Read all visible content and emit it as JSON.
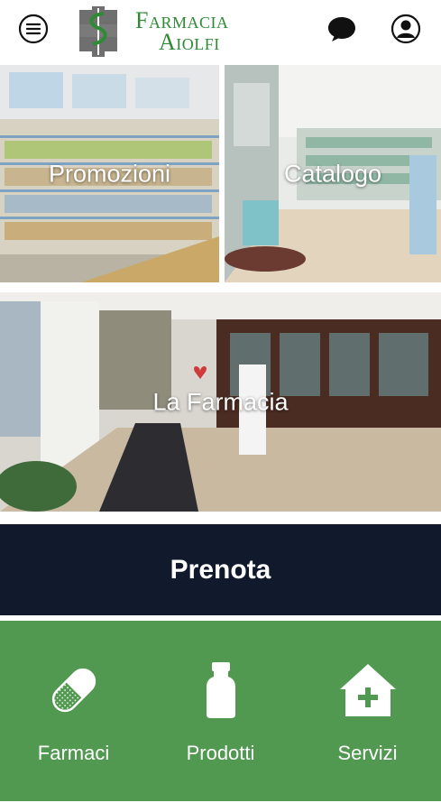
{
  "header": {
    "logo_line1": "Farmacia",
    "logo_line2": "Aiolfi",
    "menu_icon": "hamburger-menu-icon",
    "chat_icon": "chat-bubble-icon",
    "user_icon": "user-account-icon"
  },
  "tiles": {
    "promozioni": "Promozioni",
    "catalogo": "Catalogo",
    "farmacia": "La Farmacia"
  },
  "prenota": {
    "label": "Prenota"
  },
  "bottom_nav": {
    "items": [
      {
        "label": "Farmaci",
        "icon": "pill-capsule-icon"
      },
      {
        "label": "Prodotti",
        "icon": "bottle-icon"
      },
      {
        "label": "Servizi",
        "icon": "house-cross-icon"
      }
    ]
  },
  "colors": {
    "brand_green": "#2f8a36",
    "nav_green": "#519850",
    "prenota_bg": "#111a2d"
  }
}
